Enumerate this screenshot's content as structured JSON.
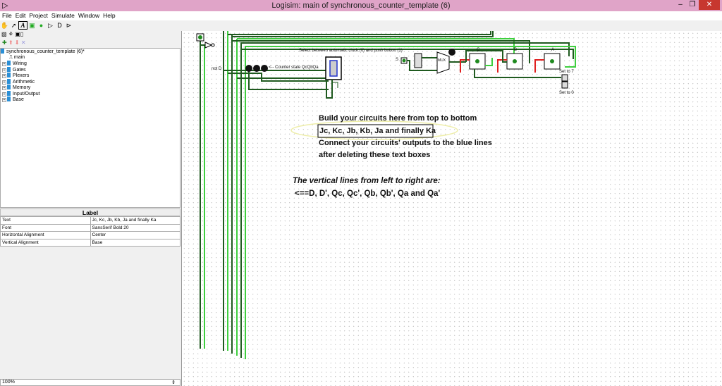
{
  "window": {
    "title": "Logisim: main of synchronous_counter_template (6)",
    "minimize": "–",
    "maximize": "❐",
    "close": "✕"
  },
  "menu": [
    "File",
    "Edit",
    "Project",
    "Simulate",
    "Window",
    "Help"
  ],
  "tree": {
    "project": "synchronous_counter_template (6)*",
    "main": "main",
    "libraries": [
      "Wiring",
      "Gates",
      "Plexers",
      "Arithmetic",
      "Memory",
      "Input/Output",
      "Base"
    ]
  },
  "properties": {
    "header": "Label",
    "rows": [
      {
        "name": "Text",
        "value": "Jc, Kc, Jb, Kb, Ja and finally Ka"
      },
      {
        "name": "Font",
        "value": "SansSerif Bold 20"
      },
      {
        "name": "Horizontal Alignment",
        "value": "Center"
      },
      {
        "name": "Vertical Alignment",
        "value": "Base"
      }
    ]
  },
  "zoom": "100%",
  "circuit": {
    "clock_select_label": "Select between automatic clock (0) and push button (1)",
    "counter_state_label": "<-- Counter state QcQbQa",
    "not_d_label": "not D",
    "s_label": "S",
    "mux_label": "MUX",
    "ff_labels": [
      "C",
      "B",
      "A"
    ],
    "set7": "Set to 7",
    "set0": "Set to 0",
    "instructions": [
      "Build your circuits here from top to bottom",
      "Jc, Kc, Jb, Kb, Ja and finally Ka",
      "Connect your circuits' outputs to the blue lines",
      "after deleting these text boxes"
    ],
    "vertical_note": [
      "The vertical lines from left to right are:",
      "<==D, D', Qc, Qc', Qb, Qb', Qa and Qa'"
    ]
  }
}
